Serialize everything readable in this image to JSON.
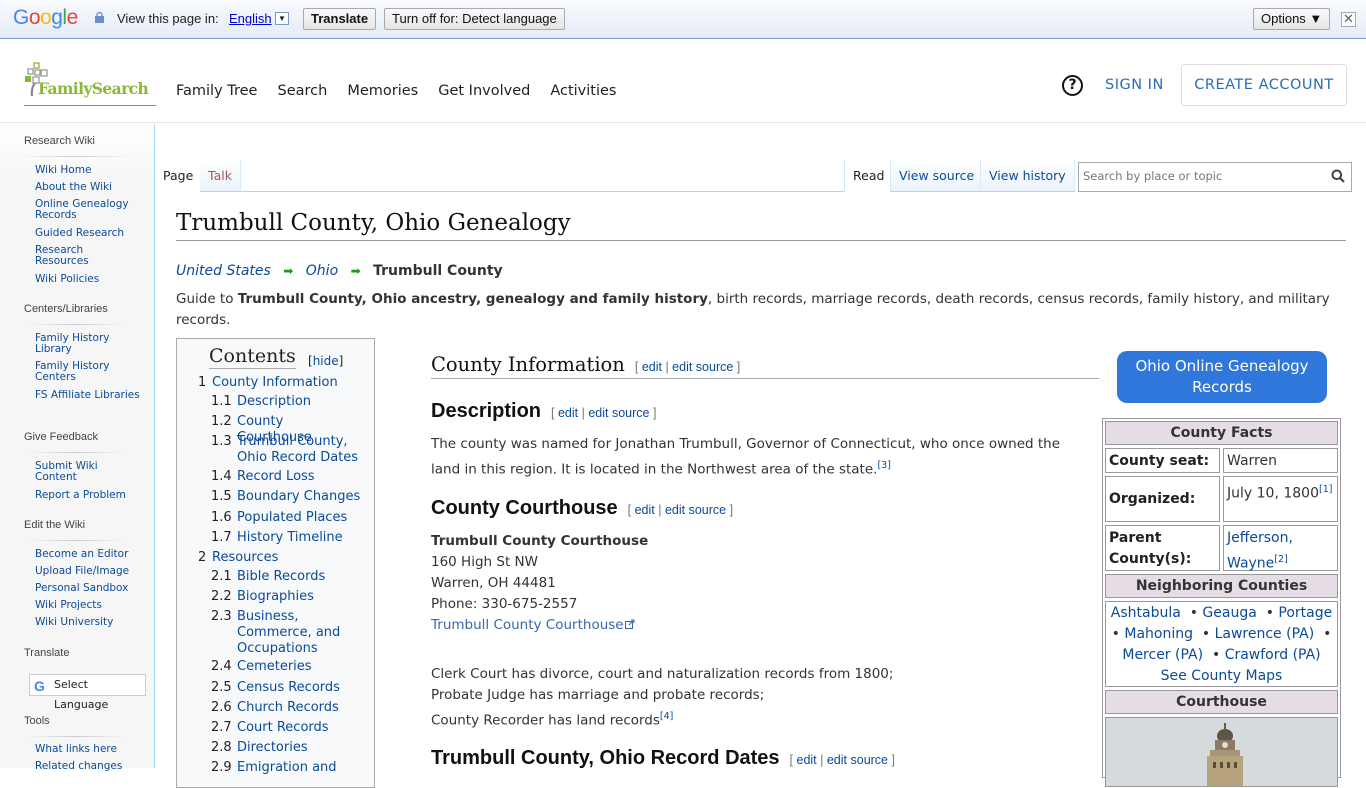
{
  "translate_bar": {
    "logo": "Google",
    "view_label": "View this page in:",
    "language": "English",
    "translate_button": "Translate",
    "turn_off_button": "Turn off for: Detect language",
    "options_button": "Options ▼",
    "close": "✕"
  },
  "header": {
    "logo_text": "FamilySearch",
    "nav": [
      "Family Tree",
      "Search",
      "Memories",
      "Get Involved",
      "Activities"
    ],
    "help": "?",
    "sign_in": "SIGN IN",
    "create_account": "CREATE ACCOUNT"
  },
  "sidebar": {
    "sections": [
      {
        "heading": "Research Wiki",
        "items": [
          "Wiki Home",
          "About the Wiki",
          "Online Genealogy Records",
          "Guided Research",
          "Research Resources",
          "Wiki Policies"
        ]
      },
      {
        "heading": "Centers/Libraries",
        "items": [
          "Family History Library",
          "Family History Centers",
          "FS Affiliate Libraries"
        ]
      },
      {
        "heading": "Give Feedback",
        "items": [
          "Submit Wiki Content",
          "Report a Problem"
        ]
      },
      {
        "heading": "Edit the Wiki",
        "items": [
          "Become an Editor",
          "Upload File/Image",
          "Personal Sandbox",
          "Wiki Projects",
          "Wiki University"
        ]
      },
      {
        "heading": "Translate",
        "items": []
      },
      {
        "heading": "Tools",
        "items": [
          "What links here",
          "Related changes"
        ]
      }
    ],
    "translate_widget": "Select Language"
  },
  "tabs": {
    "page": "Page",
    "talk": "Talk",
    "read": "Read",
    "view_source": "View source",
    "view_history": "View history",
    "search_placeholder": "Search by place or topic"
  },
  "article": {
    "title": "Trumbull County, Ohio Genealogy",
    "breadcrumb": [
      "United States",
      "Ohio",
      "Trumbull County"
    ],
    "intro_prefix": "Guide to ",
    "intro_bold": "Trumbull County, Ohio ancestry, genealogy and family history",
    "intro_suffix": ", birth records, marriage records, death records, census records, family history, and military records.",
    "toc": {
      "title": "Contents",
      "hide": "hide",
      "entries": [
        {
          "num": "1",
          "text": "County Information"
        },
        {
          "num": "1.1",
          "text": "Description"
        },
        {
          "num": "1.2",
          "text": "County Courthouse"
        },
        {
          "num": "1.3",
          "text": "Trumbull County, Ohio Record Dates"
        },
        {
          "num": "1.4",
          "text": "Record Loss"
        },
        {
          "num": "1.5",
          "text": "Boundary Changes"
        },
        {
          "num": "1.6",
          "text": "Populated Places"
        },
        {
          "num": "1.7",
          "text": "History Timeline"
        },
        {
          "num": "2",
          "text": "Resources"
        },
        {
          "num": "2.1",
          "text": "Bible Records"
        },
        {
          "num": "2.2",
          "text": "Biographies"
        },
        {
          "num": "2.3",
          "text": "Business, Commerce, and Occupations"
        },
        {
          "num": "2.4",
          "text": "Cemeteries"
        },
        {
          "num": "2.5",
          "text": "Census Records"
        },
        {
          "num": "2.6",
          "text": "Church Records"
        },
        {
          "num": "2.7",
          "text": "Court Records"
        },
        {
          "num": "2.8",
          "text": "Directories"
        },
        {
          "num": "2.9",
          "text": "Emigration and"
        }
      ]
    },
    "edit": "edit",
    "edit_source": "edit source",
    "sections": {
      "county_info": "County Information",
      "description": "Description",
      "description_text": "The county was named for Jonathan Trumbull, Governor of Connecticut, who once owned the land in this region. It is located in the Northwest area of the state.",
      "description_ref": "[3]",
      "courthouse": "County Courthouse",
      "courthouse_name": "Trumbull County Courthouse",
      "address1": "160 High St NW",
      "address2": "Warren, OH 44481",
      "phone": "Phone: 330-675-2557",
      "courthouse_link": "Trumbull County Courthouse",
      "clerk": "Clerk Court has divorce, court and naturalization records from 1800;",
      "probate": "Probate Judge has marriage and probate records;",
      "recorder": "County Recorder has land records",
      "recorder_ref": "[4]",
      "record_dates": "Trumbull County, Ohio Record Dates"
    }
  },
  "infobox": {
    "button": "Ohio Online Genealogy Records",
    "facts_heading": "County Facts",
    "seat_label": "County seat:",
    "seat_value": "Warren",
    "organized_label": "Organized:",
    "organized_value": "July 10, 1800",
    "organized_ref": "[1]",
    "parent_label": "Parent County(s):",
    "parent_value": "Jefferson, Wayne",
    "parent_ref": "[2]",
    "neighbors_heading": "Neighboring Counties",
    "neighbors": [
      "Ashtabula",
      "Geauga",
      "Portage",
      "Mahoning",
      "Lawrence (PA)",
      "Mercer (PA)",
      "Crawford (PA)"
    ],
    "county_maps": "See County Maps",
    "courthouse_heading": "Courthouse"
  },
  "colors": {
    "link": "#0b4a98",
    "fs_green": "#8cb839",
    "accent_button": "#2f77db",
    "infobox_header": "#e5dce6",
    "breadcrumb_arrow": "#1a9c1a"
  }
}
